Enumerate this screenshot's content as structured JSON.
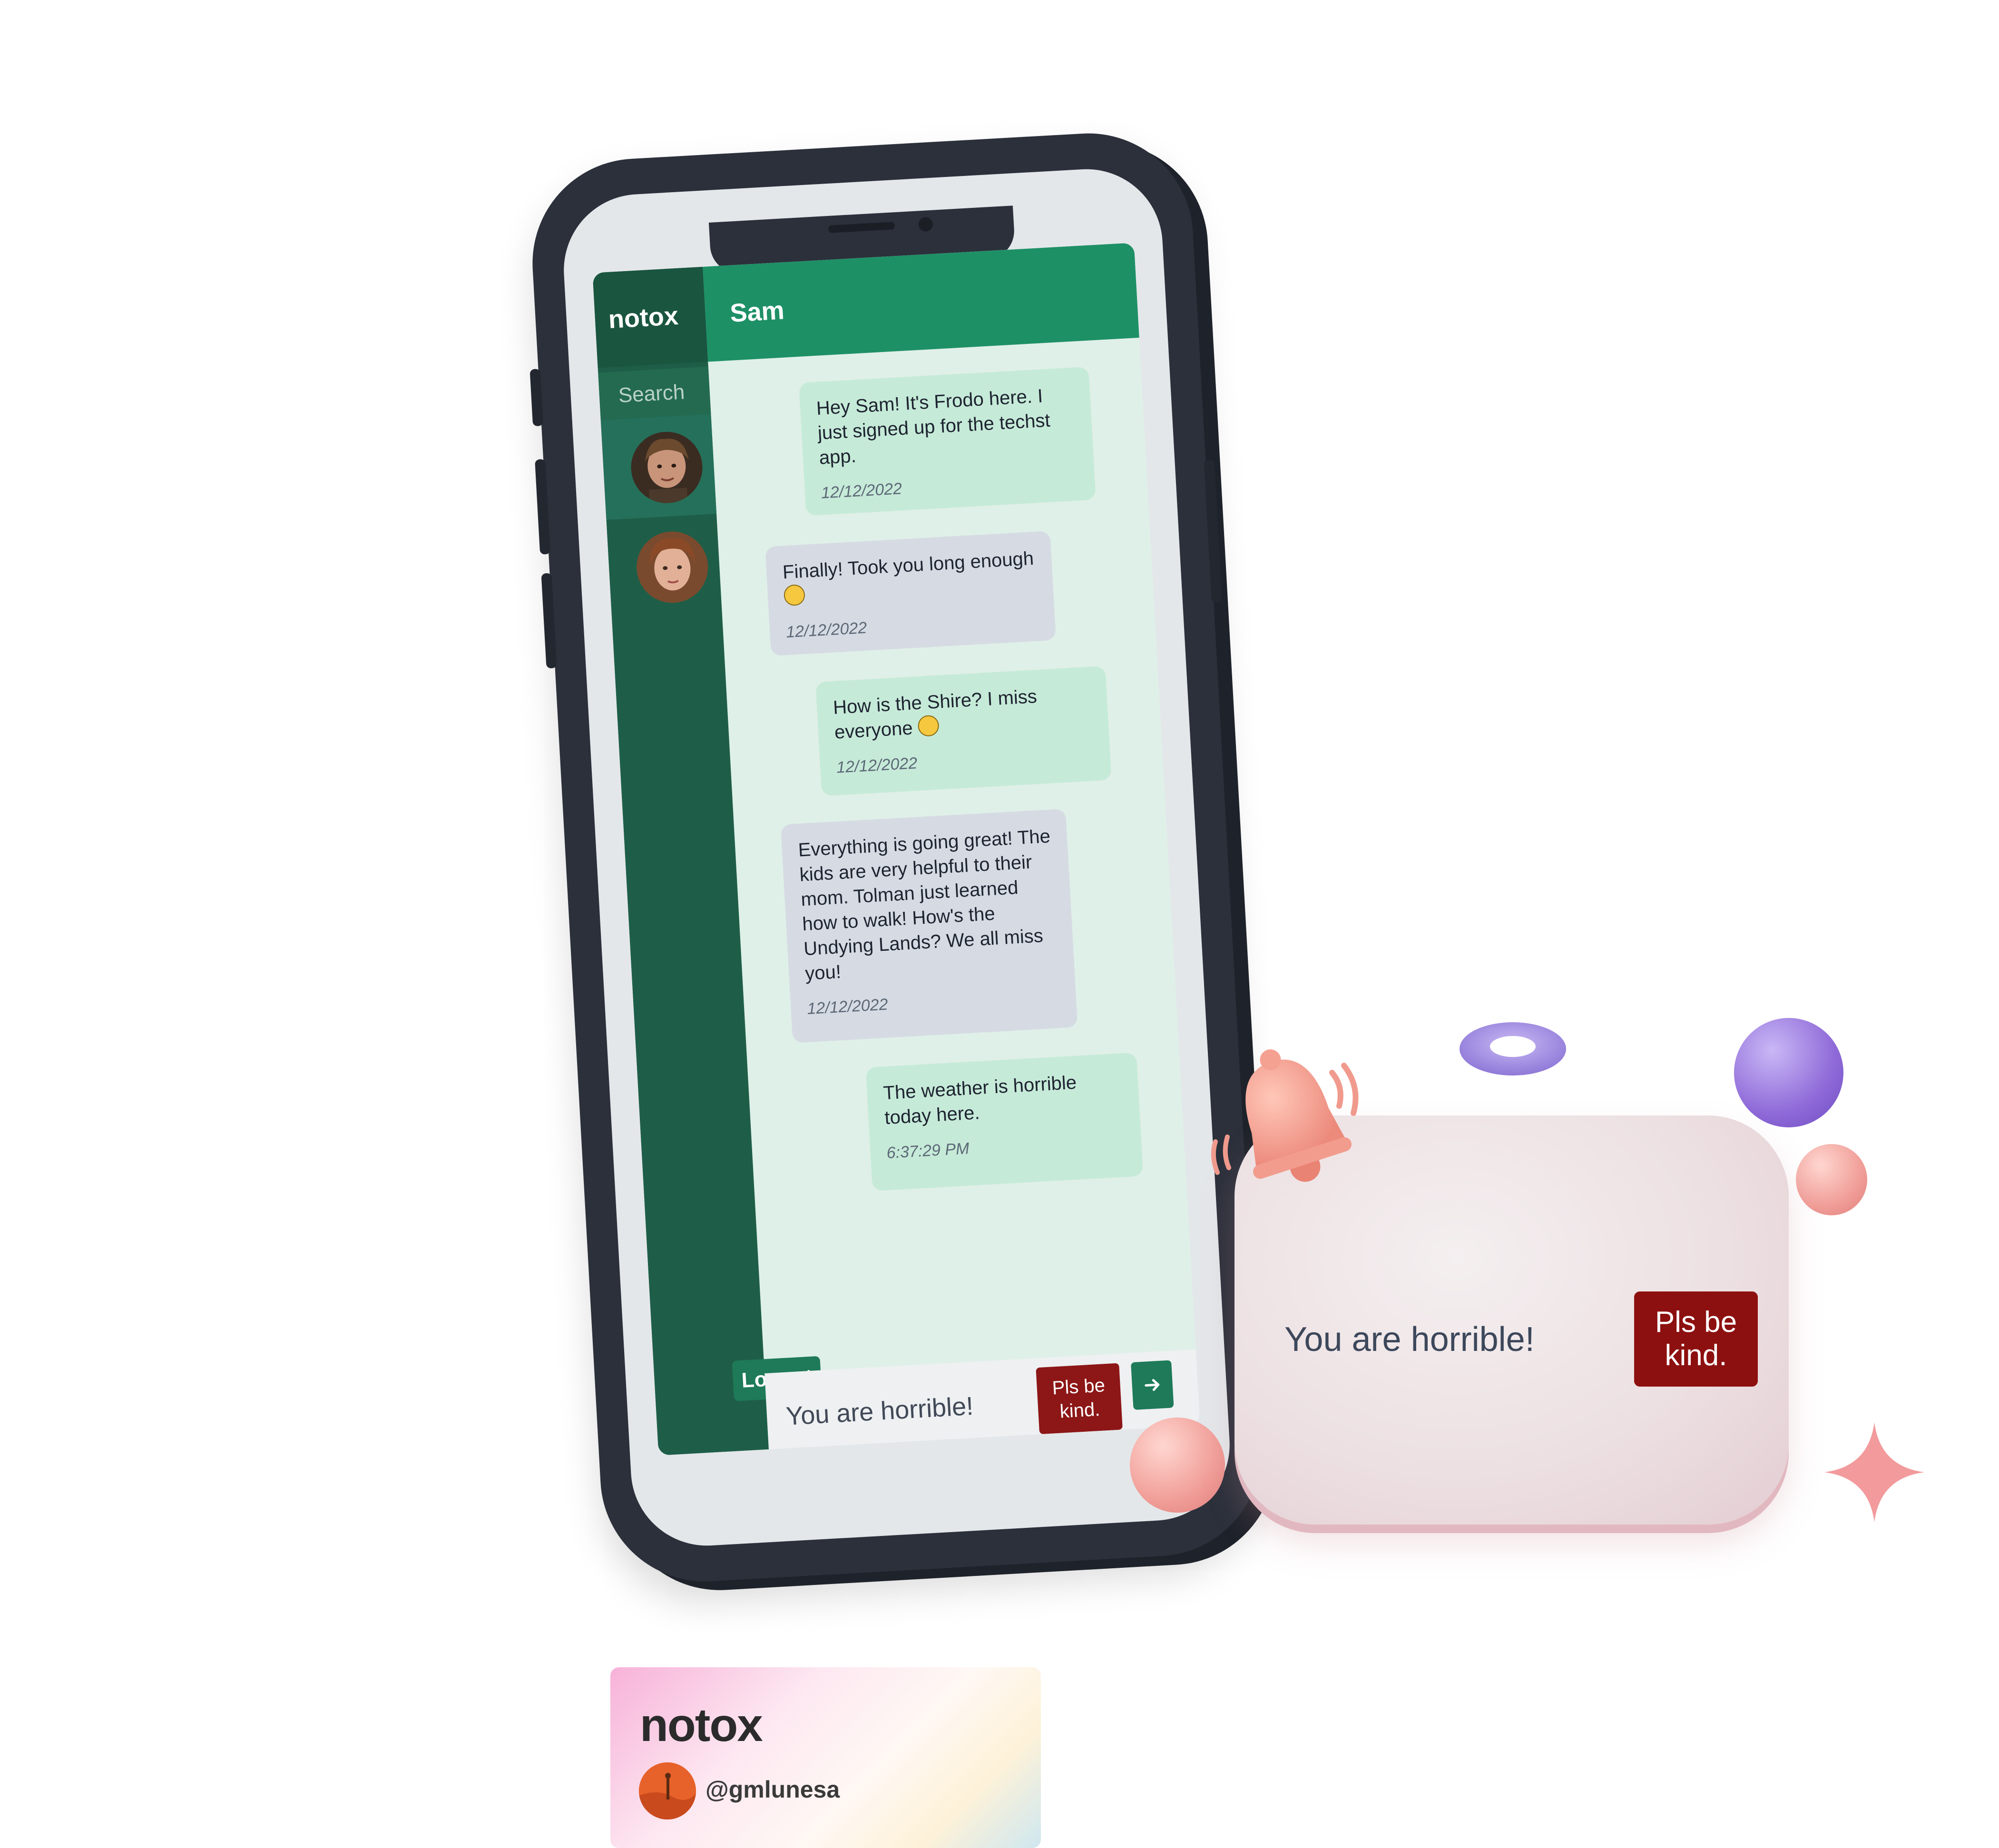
{
  "app": {
    "brand": "notox",
    "search_placeholder": "Search",
    "chat_title": "Sam",
    "logout_label": "Logout",
    "contacts": [
      {
        "name": "contact-1",
        "active": true
      },
      {
        "name": "contact-2",
        "active": false
      }
    ],
    "messages": [
      {
        "side": "me",
        "text": "Hey Sam! It's Frodo here. I just signed up for the techst app.",
        "time": "12/12/2022"
      },
      {
        "side": "them",
        "text": "Finally! Took you long enough",
        "emoji": "smile",
        "time": "12/12/2022"
      },
      {
        "side": "me",
        "text": "How is the Shire? I miss everyone",
        "emoji": "sad",
        "time": "12/12/2022"
      },
      {
        "side": "them",
        "text": "Everything is going great! The kids are very helpful to their mom. Tolman just learned how to walk! How's the Undying Lands? We all miss you!",
        "time": "12/12/2022"
      },
      {
        "side": "me",
        "text": "The weather is horrible today here.",
        "time": "6:37:29 PM"
      }
    ],
    "input_value": "You are horrible!",
    "warning_button": "Pls be kind.",
    "send_icon": "arrow-right-icon"
  },
  "notification": {
    "text": "You are horrible!",
    "button": "Pls be kind.",
    "icon": "bell-icon"
  },
  "footer": {
    "title": "notox",
    "handle": "@gmlunesa"
  },
  "colors": {
    "sidebar": "#1e5e48",
    "header": "#1e9066",
    "my_bubble": "#c6ead8",
    "their_bubble": "#d6dbe3",
    "warning": "#8d1616"
  }
}
